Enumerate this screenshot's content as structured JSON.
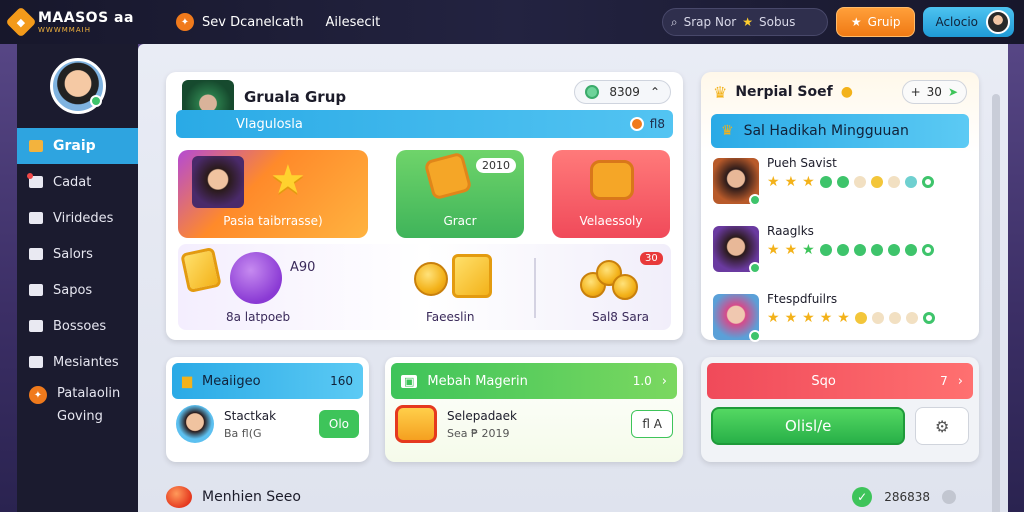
{
  "app": {
    "logo_title": "MAASOS aa",
    "logo_sub": "WWWMMAIH"
  },
  "topnav": {
    "item1": "Sev Dcanelcath",
    "item2": "Ailesecit"
  },
  "search": {
    "text": "Srap Nor",
    "extra": "Sobus"
  },
  "header_buttons": {
    "orange": "Gruip",
    "blue": "Aclocio"
  },
  "sidebar": {
    "items": [
      {
        "label": "Graip",
        "active": true
      },
      {
        "label": "Cadat"
      },
      {
        "label": "Viridedes"
      },
      {
        "label": "Salors"
      },
      {
        "label": "Sapos"
      },
      {
        "label": "Bossoes"
      },
      {
        "label": "Mesiantes"
      }
    ],
    "bottom_line1": "Patalaolin",
    "bottom_line2": "Goving"
  },
  "group_card": {
    "title": "Gruala Grup",
    "pill_value": "8309",
    "bar_label": "Vlagulosla",
    "bar_count": "fl8",
    "tile1_label": "Pasia taibrrasse)",
    "tile2_tag": "2010",
    "tile2_label": "Gracr",
    "tile3_label": "Velaessoly",
    "bottom_value": "A90",
    "bottom_left_label": "8a latpoeb",
    "bottom_mid_label": "Faeeslin",
    "bottom_right_label": "Sal8 Sara",
    "bottom_badge": "30"
  },
  "leaderboard": {
    "title": "Nerpial Soef",
    "pill_value": "30",
    "bar_label": "Sal Hadikah Mingguuan",
    "rows": [
      {
        "name": "Pueh Savist"
      },
      {
        "name": "Raaglks"
      },
      {
        "name": "Ftespdfuilrs"
      }
    ]
  },
  "card_blue": {
    "title": "Meaiigeo",
    "count": "160",
    "name": "Stactkak",
    "sub": "Ba fl(G",
    "button": "Olo"
  },
  "card_green": {
    "title": "Mebah Magerin",
    "count": "1.0",
    "name": "Selepadaek",
    "sub": "Sea ₱ 2019",
    "button": "fl A"
  },
  "card_red": {
    "title": "Sqo",
    "count": "7",
    "button": "Olisl/e"
  },
  "footer": {
    "title": "Menhien Seeo",
    "value": "286838"
  },
  "colors": {
    "accent_blue": "#2aaae6",
    "accent_green": "#3ec45a",
    "accent_orange": "#f07a1c",
    "accent_red": "#f04a5a"
  }
}
